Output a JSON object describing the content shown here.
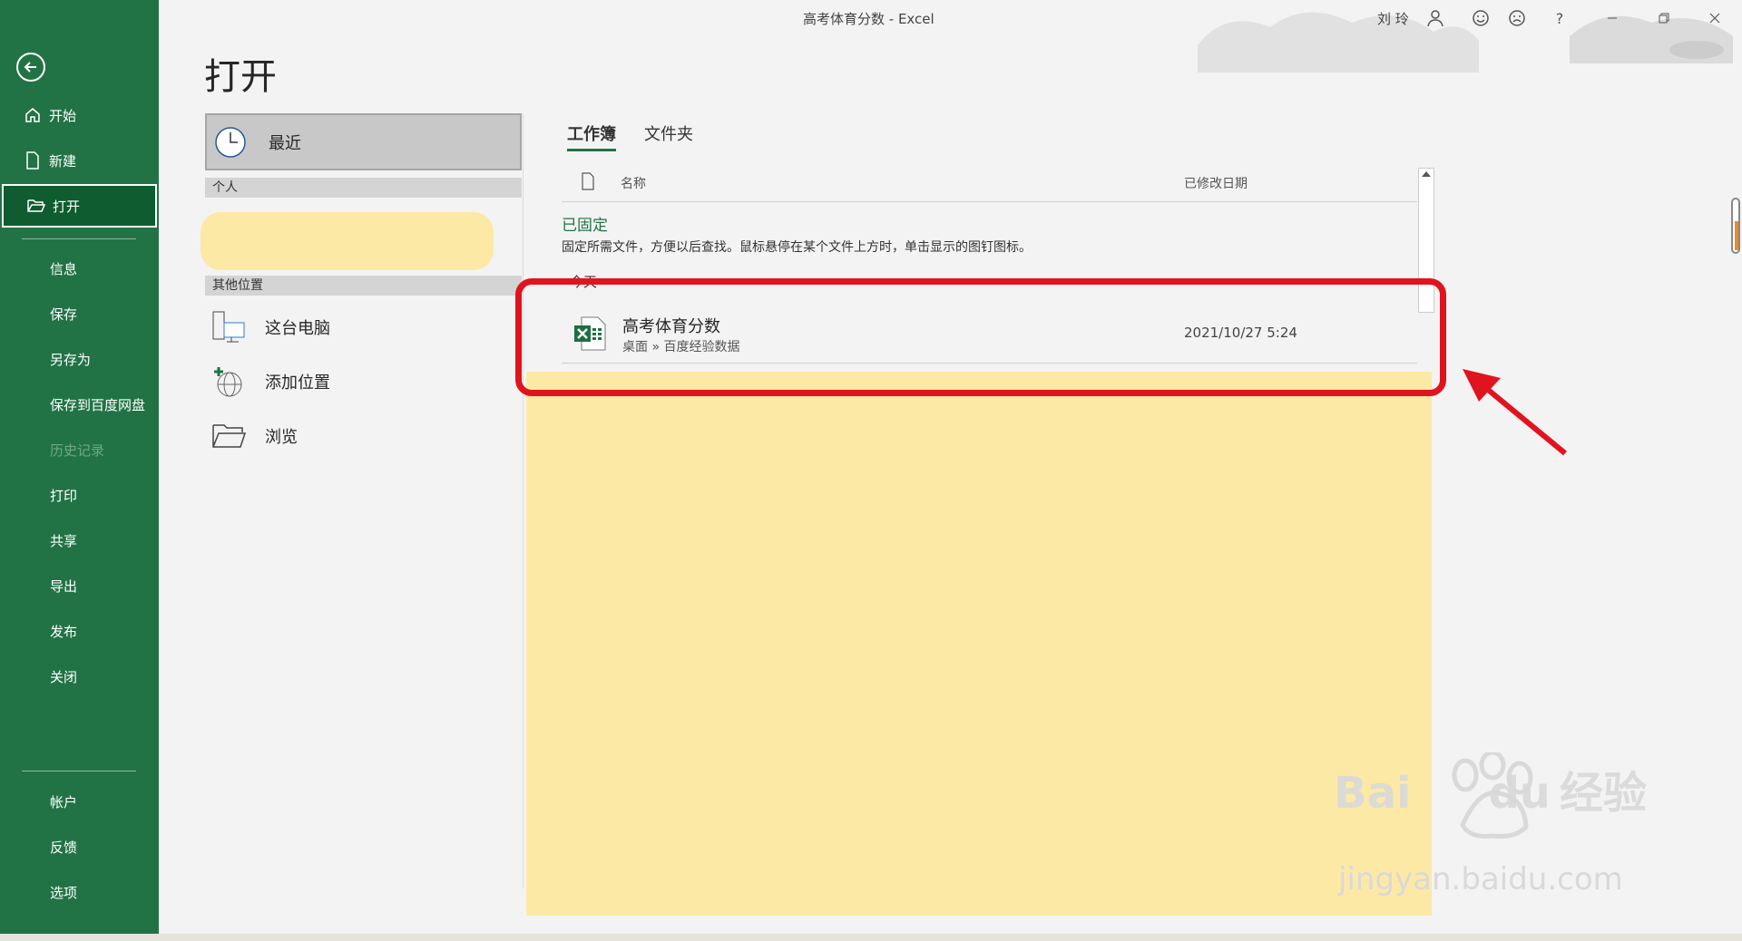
{
  "window": {
    "title": "高考体育分数 - Excel",
    "user": "刘 玲",
    "buttons": [
      "person-icon",
      "smile-icon",
      "frown-icon",
      "?",
      "minimize",
      "restore",
      "close"
    ],
    "help_label": "?"
  },
  "sidebar": {
    "items": [
      {
        "label": "开始",
        "icon": "home-icon"
      },
      {
        "label": "新建",
        "icon": "file-icon"
      },
      {
        "label": "打开",
        "icon": "folder-open-icon",
        "active": true
      },
      {
        "label": "信息"
      },
      {
        "label": "保存"
      },
      {
        "label": "另存为"
      },
      {
        "label": "保存到百度网盘"
      },
      {
        "label": "历史记录",
        "disabled": true
      },
      {
        "label": "打印"
      },
      {
        "label": "共享"
      },
      {
        "label": "导出"
      },
      {
        "label": "发布"
      },
      {
        "label": "关闭"
      },
      {
        "label": "帐户"
      },
      {
        "label": "反馈"
      },
      {
        "label": "选项"
      }
    ]
  },
  "page": {
    "title": "打开",
    "recent_label": "最近",
    "personal_header": "个人",
    "other_header": "其他位置",
    "other_locations": [
      {
        "label": "这台电脑",
        "icon": "computer-icon"
      },
      {
        "label": "添加位置",
        "icon": "add-location-icon"
      },
      {
        "label": "浏览",
        "icon": "folder-icon"
      }
    ]
  },
  "files": {
    "tabs": [
      "工作簿",
      "文件夹"
    ],
    "active_tab": "工作簿",
    "col_name": "名称",
    "col_date": "已修改日期",
    "pinned_title": "已固定",
    "pinned_desc": "固定所需文件，方便以后查找。鼠标悬停在某个文件上方时，单击显示的图钉图标。",
    "today_label": "今天",
    "rows": [
      {
        "name": "高考体育分数",
        "path": "桌面 » 百度经验数据",
        "date": "2021/10/27 5:24"
      }
    ]
  },
  "watermark": {
    "main": "Bai",
    "du": "du",
    "cn": "经验",
    "sub": "jingyan.baidu.com"
  },
  "colors": {
    "sidebar": "#217346",
    "active": "#0e5c2f",
    "highlight": "#fde9a6",
    "annotation": "#e0141e"
  }
}
